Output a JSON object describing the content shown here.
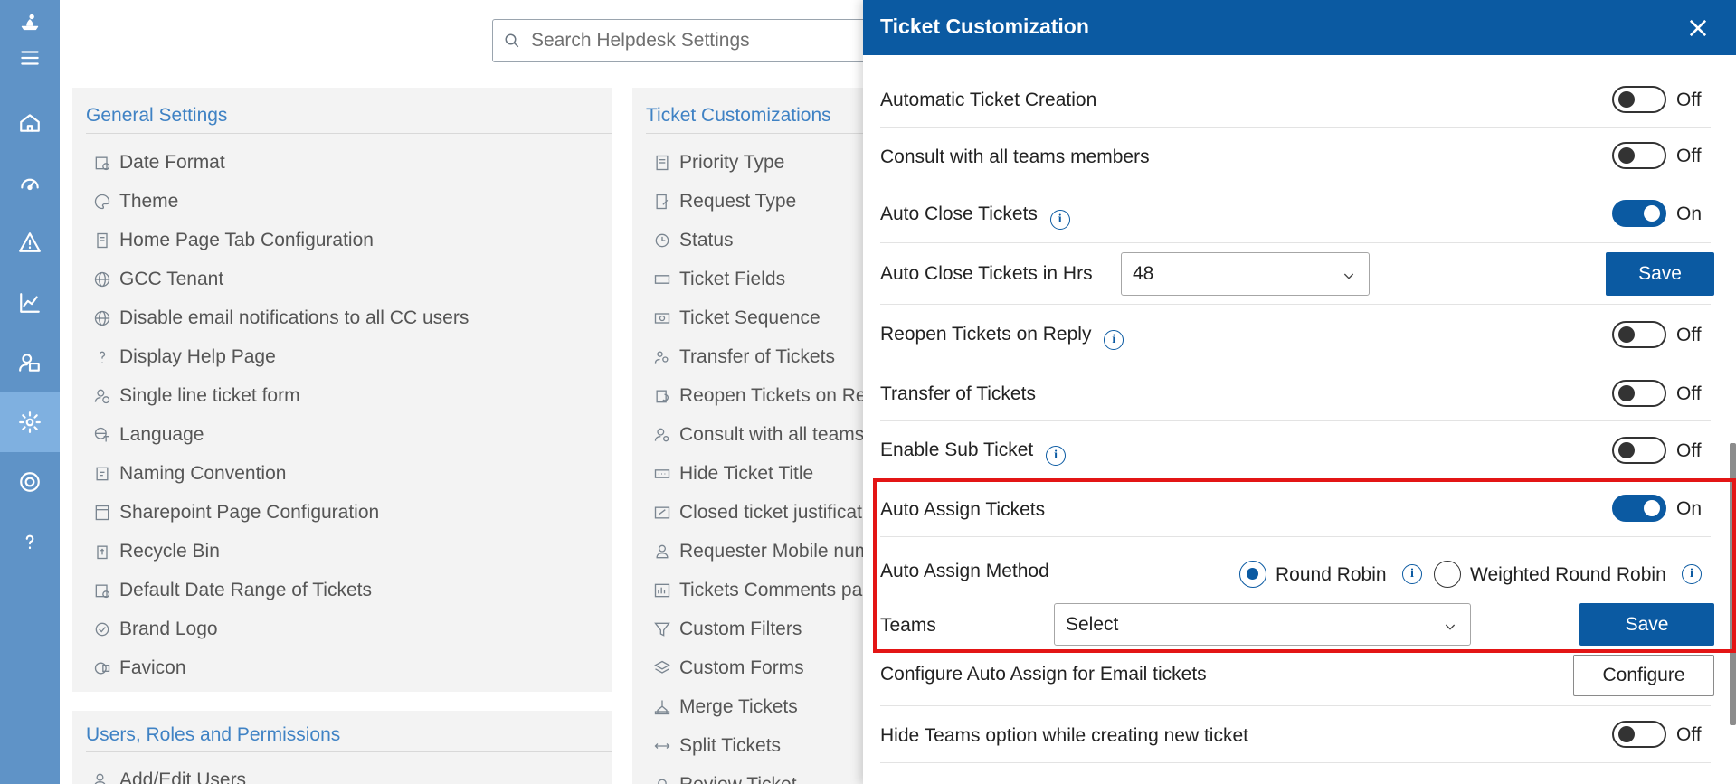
{
  "search": {
    "placeholder": "Search Helpdesk Settings"
  },
  "rail": {
    "items": [
      "logo-icon",
      "menu-icon",
      "home-icon",
      "dashboard-icon",
      "alert-icon",
      "analytics-icon",
      "users-icon",
      "settings-icon",
      "support-icon",
      "help-icon"
    ],
    "active": "settings-icon"
  },
  "general_settings": {
    "title": "General Settings",
    "items": [
      "Date Format",
      "Theme",
      "Home Page Tab Configuration",
      "GCC Tenant",
      "Disable email notifications to all CC users",
      "Display Help Page",
      "Single line ticket form",
      "Language",
      "Naming Convention",
      "Sharepoint Page Configuration",
      "Recycle Bin",
      "Default Date Range of Tickets",
      "Brand Logo",
      "Favicon"
    ]
  },
  "users_roles": {
    "title": "Users, Roles and Permissions",
    "items": [
      "Add/Edit Users"
    ]
  },
  "ticket_customizations": {
    "title": "Ticket Customizations",
    "items": [
      "Priority Type",
      "Request Type",
      "Status",
      "Ticket Fields",
      "Ticket Sequence",
      "Transfer of Tickets",
      "Reopen Tickets on Rep",
      "Consult with all teams",
      "Hide Ticket Title",
      "Closed ticket justificati",
      "Requester Mobile num",
      "Tickets Comments pag",
      "Custom Filters",
      "Custom Forms",
      "Merge Tickets",
      "Split Tickets",
      "Review Ticket"
    ]
  },
  "drawer": {
    "title": "Ticket Customization",
    "rows": {
      "automatic_ticket_creation": {
        "label": "Automatic Ticket Creation",
        "state": "Off"
      },
      "consult_all_teams": {
        "label": "Consult with all teams members",
        "state": "Off"
      },
      "auto_close": {
        "label": "Auto Close Tickets",
        "state": "On"
      },
      "auto_close_hrs": {
        "label": "Auto Close Tickets in Hrs",
        "value": "48",
        "save": "Save"
      },
      "reopen_on_reply": {
        "label": "Reopen Tickets on Reply",
        "state": "Off"
      },
      "transfer": {
        "label": "Transfer of Tickets",
        "state": "Off"
      },
      "sub_ticket": {
        "label": "Enable Sub Ticket",
        "state": "Off"
      },
      "auto_assign": {
        "label": "Auto Assign Tickets",
        "state": "On"
      },
      "auto_assign_method": {
        "label": "Auto Assign Method",
        "options": [
          "Round Robin",
          "Weighted Round Robin"
        ],
        "selected": "Round Robin"
      },
      "teams": {
        "label": "Teams",
        "value": "Select",
        "save": "Save"
      },
      "configure_email": {
        "label": "Configure Auto Assign for Email tickets",
        "button": "Configure"
      },
      "hide_teams": {
        "label": "Hide Teams option while creating new ticket",
        "state": "Off"
      }
    }
  },
  "colors": {
    "header": "#0b5aa2",
    "rail": "#5f93c7",
    "accent_title": "#3f82c4",
    "highlight": "#e31515"
  }
}
